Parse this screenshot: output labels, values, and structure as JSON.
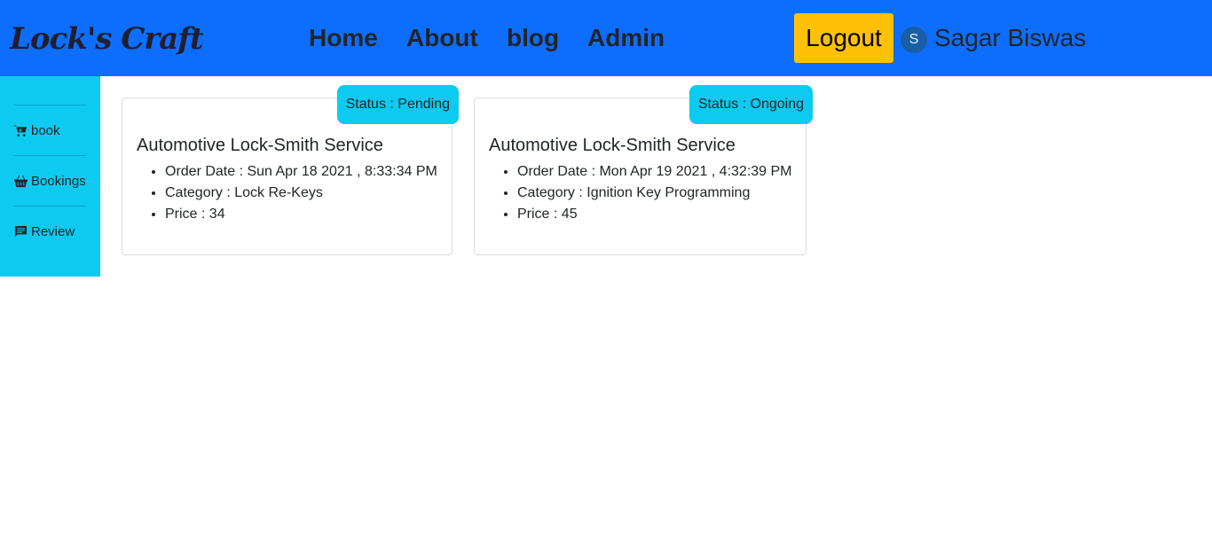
{
  "navbar": {
    "brand": "Lock's Craft",
    "links": [
      "Home",
      "About",
      "blog",
      "Admin"
    ],
    "logout_label": "Logout",
    "avatar_initial": "S",
    "user_name": "Sagar Biswas",
    "background": "#0d6efd"
  },
  "sidebar": {
    "background": "#0dcaf0",
    "items": [
      {
        "label": "book",
        "icon": "cart-icon"
      },
      {
        "label": "Bookings",
        "icon": "basket-icon"
      },
      {
        "label": "Review",
        "icon": "chat-icon"
      }
    ]
  },
  "orders": [
    {
      "status": "Status : Pending",
      "title": "Automotive Lock-Smith Service",
      "order_date": "Order Date : Sun Apr 18 2021 , 8:33:34 PM",
      "category": "Category : Lock Re-Keys",
      "price": "Price : 34"
    },
    {
      "status": "Status : Ongoing",
      "title": "Automotive Lock-Smith Service",
      "order_date": "Order Date : Mon Apr 19 2021 , 4:32:39 PM",
      "category": "Category : Ignition Key Programming",
      "price": "Price : 45"
    }
  ],
  "colors": {
    "status_badge": "#0dcaf0",
    "logout_button": "#ffc107"
  }
}
